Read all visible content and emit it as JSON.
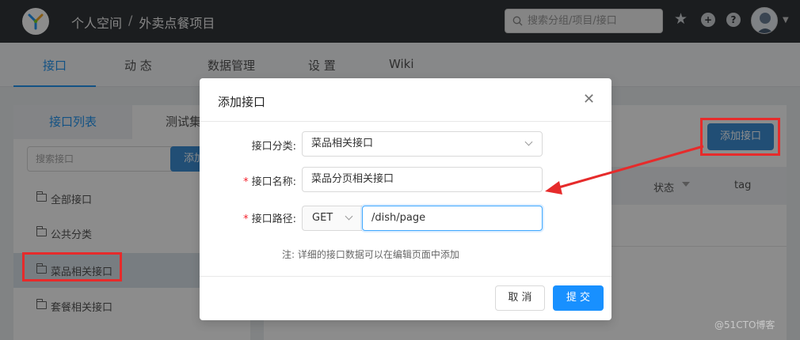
{
  "header": {
    "breadcrumb": [
      "个人空间",
      "外卖点餐项目"
    ],
    "breadcrumb_sep": "/",
    "search_placeholder": "搜索分组/项目/接口",
    "plus_icon_text": "+",
    "help_icon_text": "?"
  },
  "tabs": [
    {
      "label": "接口",
      "active": true
    },
    {
      "label": "动 态",
      "active": false
    },
    {
      "label": "数据管理",
      "active": false
    },
    {
      "label": "设 置",
      "active": false
    },
    {
      "label": "Wiki",
      "active": false
    }
  ],
  "sidebar": {
    "tab_list": "接口列表",
    "tab_test": "测试集",
    "search_placeholder": "搜索接口",
    "add_label": "添加",
    "categories": [
      {
        "label": "全部接口",
        "selected": false
      },
      {
        "label": "公共分类",
        "selected": false
      },
      {
        "label": "菜品相关接口",
        "selected": true
      },
      {
        "label": "套餐相关接口",
        "selected": false
      }
    ]
  },
  "main": {
    "add_api_label": "添加接口",
    "columns": {
      "status": "状态",
      "tag": "tag"
    }
  },
  "modal": {
    "title": "添加接口",
    "close_glyph": "✕",
    "category_label": "接口分类:",
    "category_value": "菜品相关接口",
    "name_label": "接口名称:",
    "name_value": "菜品分页相关接口",
    "path_label": "接口路径:",
    "method_value": "GET",
    "path_value": "/dish/page",
    "required_mark": "*",
    "note_prefix": "注:",
    "note_text": "详细的接口数据可以在编辑页面中添加",
    "cancel_label": "取 消",
    "submit_label": "提 交"
  },
  "watermark": "@51CTO博客",
  "colors": {
    "accent": "#2395f1",
    "primary_button": "#1890ff",
    "header_bg": "#32363a",
    "annotation_red": "#e62b2b"
  }
}
